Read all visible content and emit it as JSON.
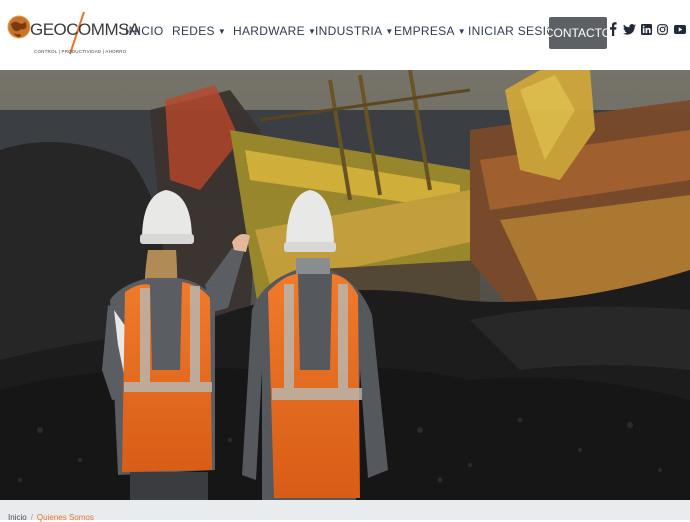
{
  "brand": {
    "name": "GEOCOMMSA",
    "tagline": "CONTROL | PRODUCTIVIDAD | AHORRO",
    "logo_icon": "globe-icon",
    "accent": "#e8732e"
  },
  "nav": {
    "items": [
      {
        "label": "INICIO",
        "dropdown": false
      },
      {
        "label": "REDES",
        "dropdown": true
      },
      {
        "label": "HARDWARE",
        "dropdown": true
      },
      {
        "label": "INDUSTRIA",
        "dropdown": true
      },
      {
        "label": "EMPRESA",
        "dropdown": true
      },
      {
        "label": "INICIAR SESION",
        "dropdown": false
      }
    ],
    "cta_label": "CONTACTO",
    "cta_color": "#5d6166"
  },
  "social": [
    {
      "icon": "facebook-icon",
      "glyph": "f"
    },
    {
      "icon": "twitter-icon",
      "glyph": ""
    },
    {
      "icon": "linkedin-icon",
      "glyph": "in"
    },
    {
      "icon": "instagram-icon",
      "glyph": ""
    },
    {
      "icon": "youtube-icon",
      "glyph": ""
    }
  ],
  "hero": {
    "image": "mining-workers-photo"
  },
  "breadcrumb": {
    "home": "Inicio",
    "separator": "/",
    "current": "Quienes Somos"
  }
}
